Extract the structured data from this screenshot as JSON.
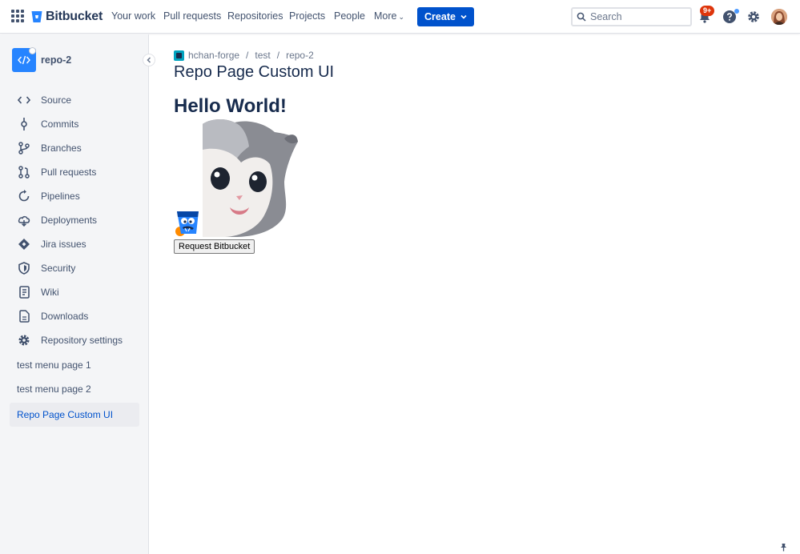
{
  "topnav": {
    "logo_text": "Bitbucket",
    "items": [
      {
        "label": "Your work"
      },
      {
        "label": "Pull requests"
      },
      {
        "label": "Repositories"
      },
      {
        "label": "Projects"
      },
      {
        "label": "People"
      },
      {
        "label": "More"
      }
    ],
    "create_label": "Create",
    "search_placeholder": "Search",
    "notification_badge": "9+"
  },
  "sidebar": {
    "repo_name": "repo-2",
    "items": [
      {
        "label": "Source",
        "icon": "code-icon"
      },
      {
        "label": "Commits",
        "icon": "commit-icon"
      },
      {
        "label": "Branches",
        "icon": "branch-icon"
      },
      {
        "label": "Pull requests",
        "icon": "pull-request-icon"
      },
      {
        "label": "Pipelines",
        "icon": "pipelines-icon"
      },
      {
        "label": "Deployments",
        "icon": "deployments-icon"
      },
      {
        "label": "Jira issues",
        "icon": "jira-icon"
      },
      {
        "label": "Security",
        "icon": "shield-icon"
      },
      {
        "label": "Wiki",
        "icon": "wiki-icon"
      },
      {
        "label": "Downloads",
        "icon": "download-icon"
      },
      {
        "label": "Repository settings",
        "icon": "gear-icon"
      },
      {
        "label": "test menu page 1"
      },
      {
        "label": "test menu page 2"
      },
      {
        "label": "Repo Page Custom UI",
        "active": true
      }
    ]
  },
  "breadcrumb": [
    "hchan-forge",
    "test",
    "repo-2"
  ],
  "main": {
    "title": "Repo Page Custom UI",
    "heading": "Hello World!",
    "button_label": "Request Bitbucket"
  },
  "colors": {
    "brand": "#0052cc",
    "sidebar_bg": "#f4f5f7",
    "text": "#172b4d",
    "secondary_text": "#42526e"
  }
}
